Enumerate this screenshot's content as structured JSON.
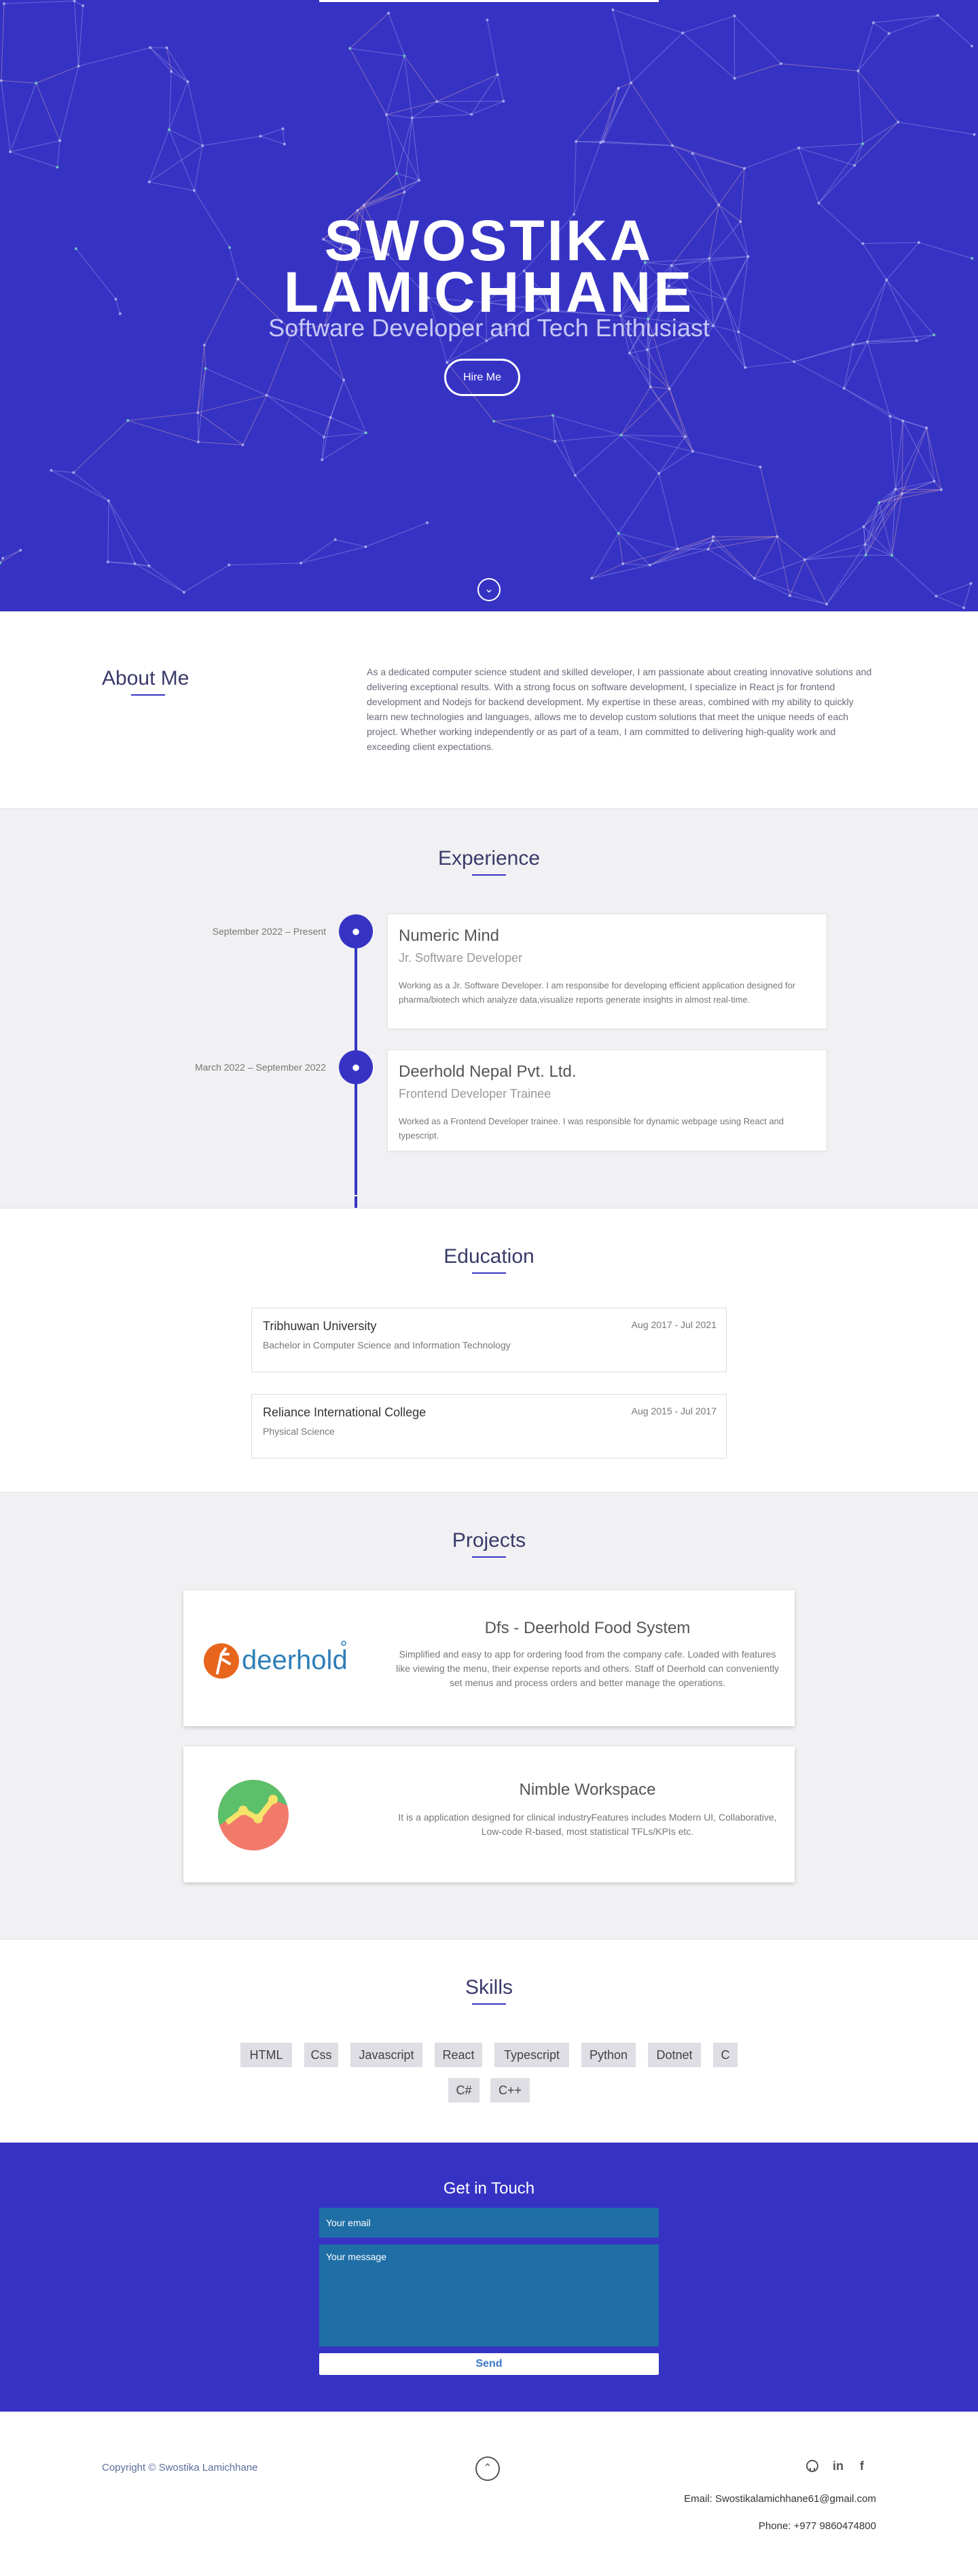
{
  "hero": {
    "name_line1": "SWOSTIKA",
    "name_line2": "LAMICHHANE",
    "subtitle": "Software Developer and Tech Enthusiast",
    "hire_label": "Hire Me",
    "scroll_icon": "chevron-down-icon"
  },
  "about": {
    "heading": "About Me",
    "text": "As a dedicated computer science student and skilled developer, I am passionate about creating innovative solutions and delivering exceptional results. With a strong focus on software development, I specialize in React js for frontend development and Nodejs for backend development. My expertise in these areas, combined with my ability to quickly learn new technologies and languages, allows me to develop custom solutions that meet the unique needs of each project. Whether working independently or as part of a team, I am committed to delivering high-quality work and exceeding client expectations."
  },
  "experience": {
    "heading": "Experience",
    "items": [
      {
        "date": "September 2022 – Present",
        "company": "Numeric Mind",
        "role": "Jr. Software Developer",
        "description": "Working as a Jr. Software Developer. I am responsibe for developing efficient application designed for pharma/biotech which analyze data,visualize reports generate insights in almost real-time."
      },
      {
        "date": "March 2022 – September 2022",
        "company": "Deerhold Nepal Pvt. Ltd.",
        "role": "Frontend Developer Trainee",
        "description": "Worked as a Frontend Developer trainee. I was responsible for dynamic webpage using React and typescript."
      }
    ]
  },
  "education": {
    "heading": "Education",
    "items": [
      {
        "school": "Tribhuwan University",
        "degree": "Bachelor in Computer Science and Information Technology",
        "years": "Aug 2017 - Jul 2021"
      },
      {
        "school": "Reliance International College",
        "degree": "Physical Science",
        "years": "Aug 2015 - Jul 2017"
      }
    ]
  },
  "projects": {
    "heading": "Projects",
    "items": [
      {
        "title": "Dfs - Deerhold Food System",
        "description": "Simplified and easy to app for ordering food from the company cafe. Loaded with features like viewing the menu, their expense reports and others. Staff of Deerhold can conveniently set menus and process orders and better manage the operations.",
        "logo_text": "deerhold"
      },
      {
        "title": "Nimble Workspace",
        "description": "It is a application designed for clinical industryFeatures includes Modern UI, Collaborative, Low-code R-based, most statistical TFLs/KPIs etc."
      }
    ]
  },
  "skills": {
    "heading": "Skills",
    "items": [
      "HTML",
      "Css",
      "Javascript",
      "React",
      "Typescript",
      "Python",
      "Dotnet",
      "C",
      "C#",
      "C++"
    ]
  },
  "contact": {
    "heading": "Get in Touch",
    "email_placeholder": "Your email",
    "message_placeholder": "Your message",
    "send_label": "Send"
  },
  "footer": {
    "copyright": "Copyright © Swostika Lamichhane",
    "email": "Email: Swostikalamichhane61@gmail.com",
    "phone": "Phone: +977 9860474800",
    "social_icons": [
      "github-icon",
      "linkedin-icon",
      "facebook-icon"
    ]
  },
  "colors": {
    "accent": "#3633c4",
    "input_bg": "#1f6fa6",
    "section_alt_bg": "#f1f1f3"
  }
}
